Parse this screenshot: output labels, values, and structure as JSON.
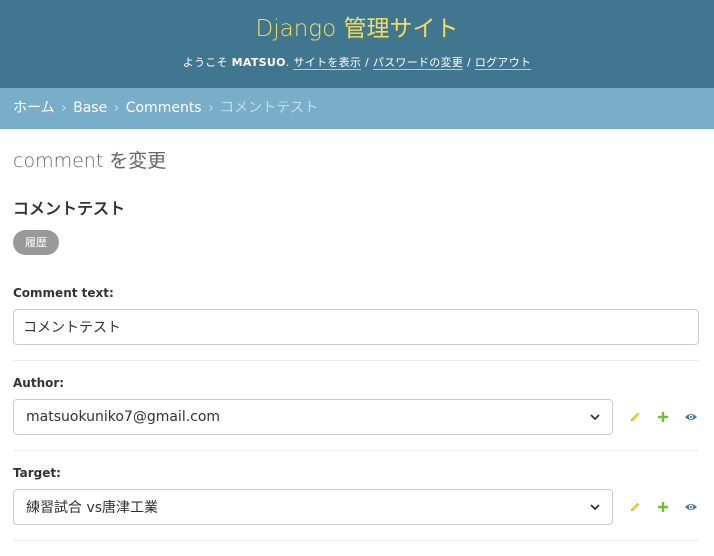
{
  "header": {
    "site_name": "Django 管理サイト",
    "welcome": "ようこそ",
    "username": "MATSUO",
    "period": ". ",
    "view_site": "サイトを表示",
    "change_password": "パスワードの変更",
    "logout": "ログアウト",
    "separator": " / "
  },
  "breadcrumbs": {
    "home": "ホーム",
    "app": "Base",
    "model": "Comments",
    "current": "コメントテスト",
    "sep": "›"
  },
  "page": {
    "title": "comment を変更",
    "object_title": "コメントテスト",
    "history_label": "履歴"
  },
  "form": {
    "comment_text": {
      "label": "Comment text:",
      "value": "コメントテスト"
    },
    "author": {
      "label": "Author:",
      "value": "matsuokuniko7@gmail.com"
    },
    "target": {
      "label": "Target:",
      "value": "練習試合 vs唐津工業"
    }
  },
  "icons": {
    "change": "pencil-icon",
    "add": "plus-icon",
    "view": "eye-icon"
  },
  "colors": {
    "header_bg": "#417690",
    "site_name": "#f5dd5d",
    "breadcrumbs_bg": "#79aec8",
    "pencil": "#efc93a",
    "plus": "#70bf2b",
    "eye": "#447e9b"
  }
}
